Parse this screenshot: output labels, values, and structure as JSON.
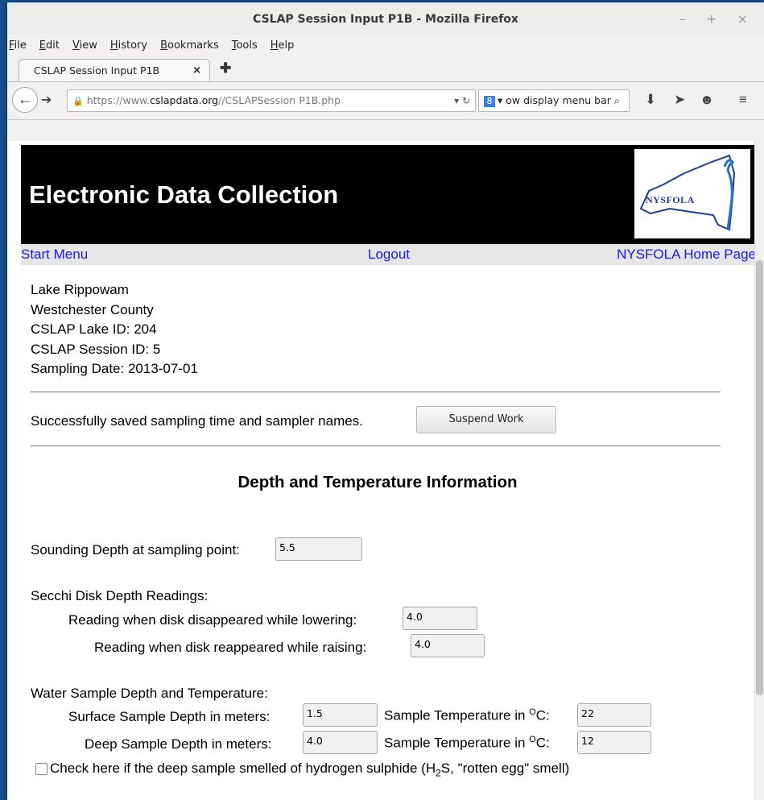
{
  "window": {
    "title": "CSLAP Session Input P1B - Mozilla Firefox",
    "controls": "– + ×"
  },
  "menubar": [
    "File",
    "Edit",
    "View",
    "History",
    "Bookmarks",
    "Tools",
    "Help"
  ],
  "tab": {
    "label": "CSLAP Session Input P1B",
    "close": "×",
    "new_tab": "✚"
  },
  "navbar": {
    "url_prefix": "https://www.",
    "url_domain": "cslapdata.org",
    "url_path": "//CSLAPSession P1B.php",
    "search_text": "ow display menu bar"
  },
  "page": {
    "banner_title": "Electronic Data Collection",
    "logo_text": "NYSFOLA",
    "links": {
      "start": "Start Menu",
      "logout": "Logout",
      "home": "NYSFOLA Home Page"
    },
    "info": {
      "lake": "Lake Rippowam",
      "county": "Westchester County",
      "lake_id": "CSLAP Lake ID: 204",
      "session_id": "CSLAP Session ID: 5",
      "date": "Sampling Date: 2013-07-01"
    },
    "status_message": "Successfully saved sampling time and sampler names.",
    "suspend_button": "Suspend Work",
    "section_title": "Depth and Temperature Information",
    "sounding": {
      "label": "Sounding Depth at sampling point:",
      "value": "5.5"
    },
    "secchi": {
      "heading": "Secchi Disk Depth Readings:",
      "lowering_label": "Reading when disk disappeared while lowering:",
      "lowering_value": "4.0",
      "raising_label": "Reading when disk reappeared while raising:",
      "raising_value": "4.0"
    },
    "water": {
      "heading": "Water Sample Depth and Temperature:",
      "surface_label": "Surface Sample Depth in meters:",
      "surface_value": "1.5",
      "temp_label_prefix": "Sample Temperature in ",
      "temp_unit_sup": "O",
      "temp_unit": "C:",
      "surface_temp": "22",
      "deep_label": "Deep Sample Depth in meters:",
      "deep_value": "4.0",
      "deep_temp": "12"
    },
    "h2s": {
      "label_a": "Check here if the deep sample smelled of hydrogen sulphide (H",
      "label_sub": "2",
      "label_b": "S, \"rotten egg\" smell)"
    }
  }
}
